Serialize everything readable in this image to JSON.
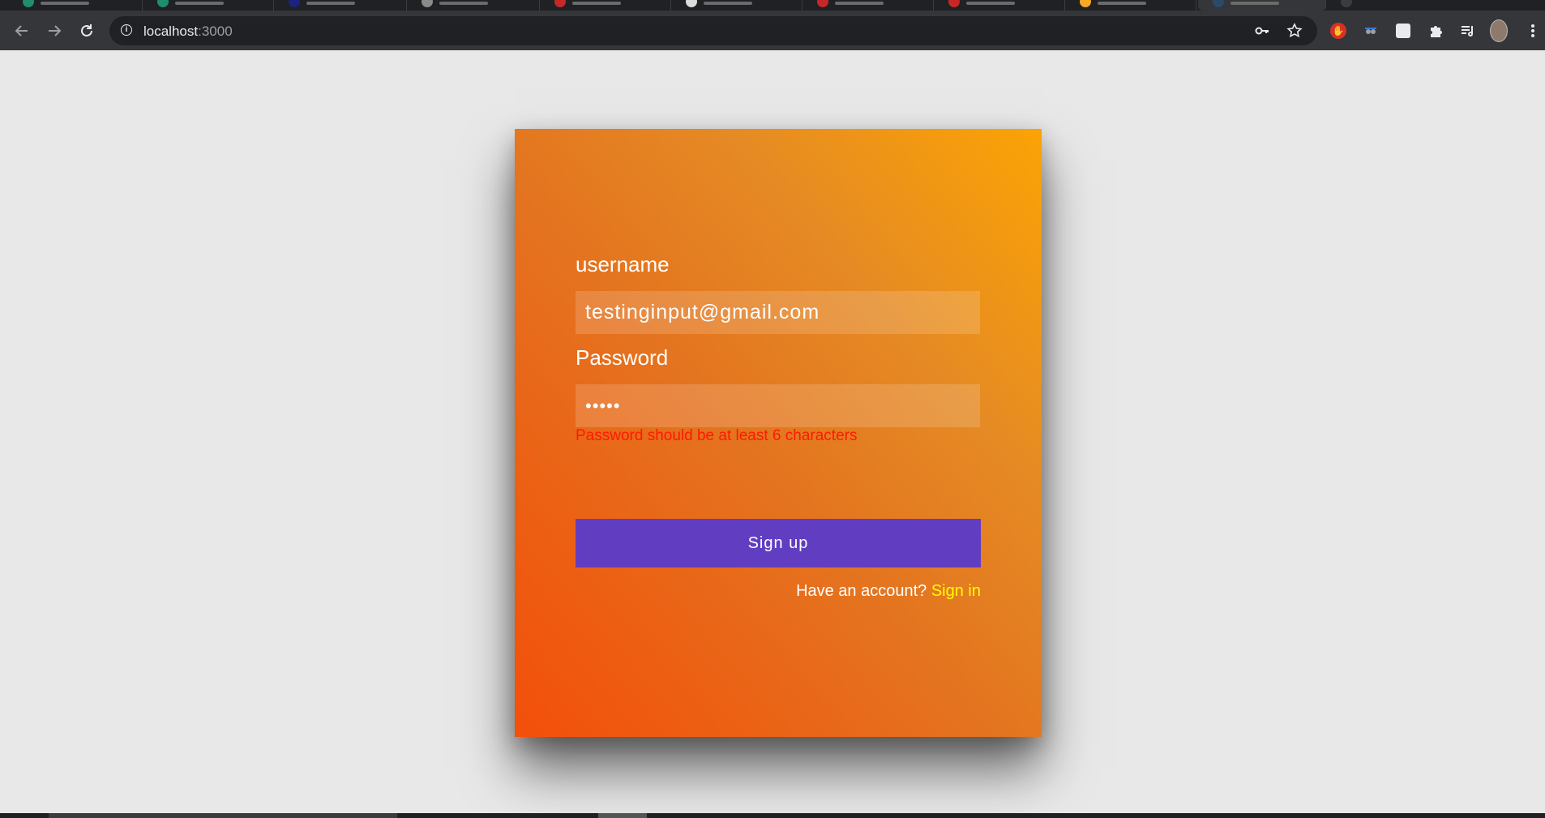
{
  "browser": {
    "url_host": "localhost",
    "url_port": ":3000",
    "icons": {
      "back": "arrow-left-icon",
      "forward": "arrow-right-icon",
      "reload": "reload-icon",
      "site_info": "info-icon",
      "password_key": "key-icon",
      "bookmark": "star-icon",
      "extensions": "puzzle-icon",
      "media": "media-queue-icon",
      "menu": "kebab-menu-icon"
    }
  },
  "form": {
    "username_label": "username",
    "username_value": "testinginput@gmail.com",
    "password_label": "Password",
    "password_value": "•••••",
    "error_text": "Password should be at least 6 characters",
    "submit_label": "Sign up",
    "have_account_text": "Have an account? ",
    "signin_link": "Sign in"
  },
  "colors": {
    "card_gradient_start": "#f34f0a",
    "card_gradient_end": "#fba305",
    "button_bg": "#613dc1",
    "error": "#ff1a00",
    "link": "#ffff00",
    "page_bg": "#e8e8e8"
  }
}
